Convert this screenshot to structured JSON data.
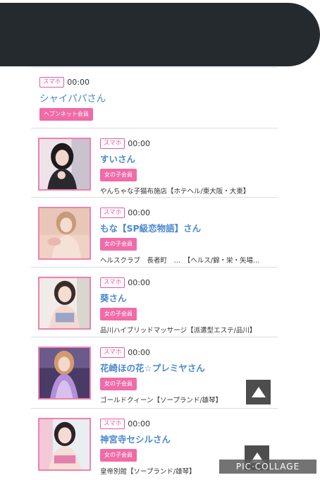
{
  "scroll_top_label": "▲",
  "watermark": "PIC·COLLAGE",
  "first_entry": {
    "device": "スマホ",
    "time": "00:00",
    "name": "シャイパパさん",
    "badge": "ヘブンネット会員"
  },
  "entries": [
    {
      "device": "スマホ",
      "time": "00:00",
      "name": "すいさん",
      "badge": "女の子会員",
      "shop": "やんちゃな子猫布施店【ホテヘル/東大阪・大東】"
    },
    {
      "device": "スマホ",
      "time": "00:00",
      "name": "もな【SP級恋物語】さん",
      "badge": "女の子会員",
      "shop": "ヘルスクラブ　長者町　…　【ヘルス/錦・栄・矢場…"
    },
    {
      "device": "スマホ",
      "time": "00:00",
      "name": "葵さん",
      "badge": "女の子会員",
      "shop": "品川ハイブリッドマッサージ【派遣型エステ/品川】"
    },
    {
      "device": "スマホ",
      "time": "00:00",
      "name": "花崎ほの花☆プレミヤさん",
      "badge": "女の子会員",
      "shop": "ゴールドクィーン【ソープランド/雄琴】"
    },
    {
      "device": "スマホ",
      "time": "00:00",
      "name": "神宮寺セシルさん",
      "badge": "女の子会員",
      "shop": "皇帝別館【ソープランド/雄琴】"
    }
  ],
  "colors": {
    "accent_pink": "#f06ba7",
    "name_blue": "#4b88cf",
    "header_dark": "#252a2f"
  }
}
